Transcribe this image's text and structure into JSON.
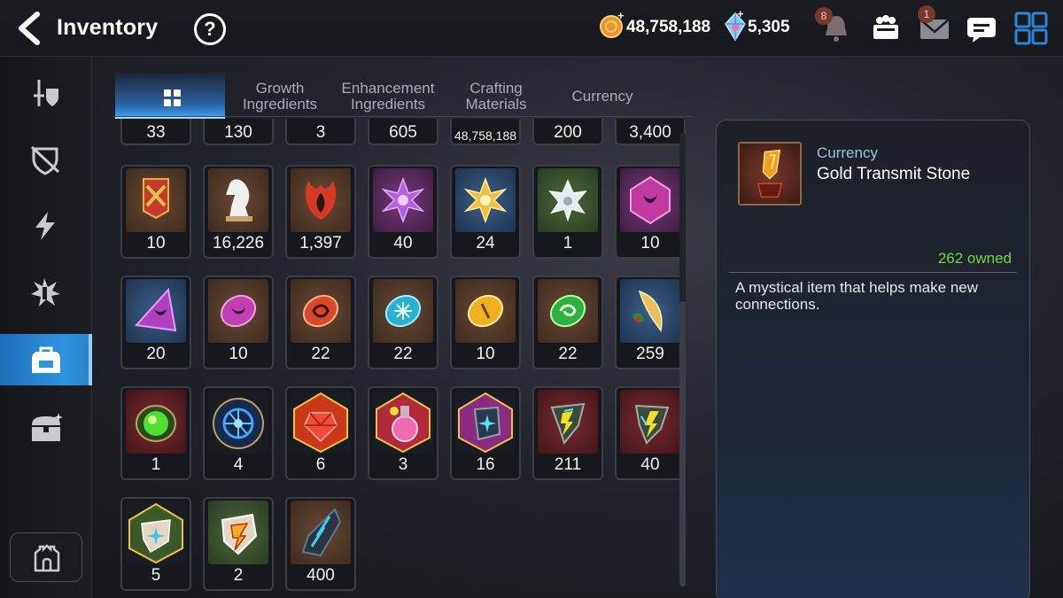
{
  "header": {
    "title": "Inventory",
    "help_label": "?",
    "gold_amount": "48,758,188",
    "gem_amount": "5,305",
    "notification_count": "8",
    "mail_count": "1"
  },
  "sidebar": {
    "items": [
      {
        "icon": "sword-shield-icon",
        "active": false
      },
      {
        "icon": "shield-icon",
        "active": false
      },
      {
        "icon": "lightning-icon",
        "active": false
      },
      {
        "icon": "burst-icon",
        "active": false
      },
      {
        "icon": "backpack-icon",
        "active": true
      },
      {
        "icon": "chest-icon",
        "active": false
      }
    ],
    "home_icon": "castle-icon"
  },
  "tabs": [
    {
      "label": "",
      "icon": "grid-icon",
      "active": true
    },
    {
      "label": "Growth\nIngredients",
      "line1": "Growth",
      "line2": "Ingredients",
      "active": false
    },
    {
      "label": "Enhancement\nIngredients",
      "line1": "Enhancement",
      "line2": "Ingredients",
      "active": false
    },
    {
      "label": "Crafting\nMaterials",
      "line1": "Crafting",
      "line2": "Materials",
      "active": false
    },
    {
      "label": "Currency",
      "line1": "Currency",
      "line2": "",
      "active": false
    }
  ],
  "grid": {
    "row0": [
      "33",
      "130",
      "3",
      "605",
      "48,758,188",
      "200",
      "3,400"
    ],
    "row1": [
      "10",
      "16,226",
      "1,397",
      "40",
      "24",
      "1",
      "10"
    ],
    "row2": [
      "20",
      "10",
      "22",
      "22",
      "10",
      "22",
      "259"
    ],
    "row3": [
      "1",
      "4",
      "6",
      "3",
      "16",
      "211",
      "40"
    ],
    "row4": [
      "5",
      "2",
      "400"
    ],
    "icons": {
      "row1": [
        "banner-icon",
        "knight-chess-icon",
        "flame-leaf-icon",
        "purple-flower-icon",
        "gold-flower-icon",
        "silver-flower-icon",
        "purple-hexagon-icon"
      ],
      "row2": [
        "purple-triangle-rune-icon",
        "purple-rune-icon",
        "red-rune-icon",
        "blue-rune-icon",
        "yellow-rune-icon",
        "green-rune-icon",
        "fish-icon"
      ],
      "row3": [
        "green-orb-icon",
        "blue-circuit-icon",
        "red-gem-icon",
        "potion-icon",
        "star-gem-icon",
        "lightning-stone-icon",
        "lightning-stone-icon"
      ],
      "row4": [
        "star-stone-icon",
        "lightning-stone-icon",
        "crystal-shard-icon"
      ]
    }
  },
  "detail": {
    "category": "Currency",
    "name": "Gold Transmit Stone",
    "owned": "262 owned",
    "description": "A mystical item that helps make new connections."
  },
  "colors": {
    "accent_blue": "#2e95e0",
    "owned_green": "#6fd83a",
    "category_text": "#8ec8e0"
  }
}
